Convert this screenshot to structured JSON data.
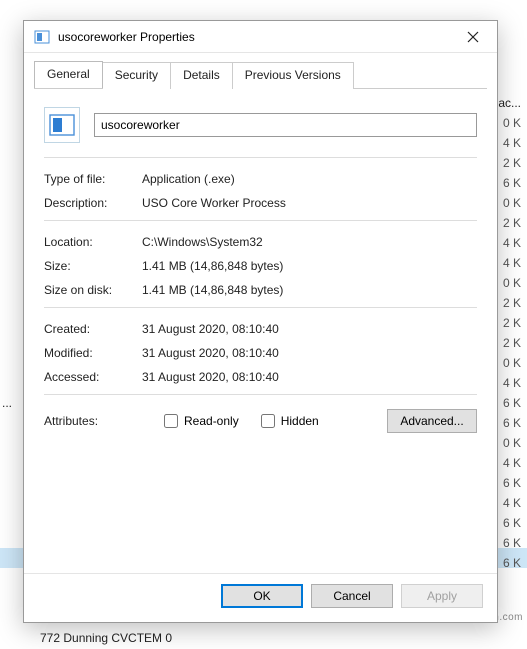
{
  "dialog": {
    "title": "usocoreworker Properties",
    "tabs": [
      "General",
      "Security",
      "Details",
      "Previous Versions"
    ],
    "active_tab": 0,
    "name_value": "usocoreworker",
    "fields": {
      "type_label": "Type of file:",
      "type_value": "Application (.exe)",
      "desc_label": "Description:",
      "desc_value": "USO Core Worker Process",
      "loc_label": "Location:",
      "loc_value": "C:\\Windows\\System32",
      "size_label": "Size:",
      "size_value": "1.41 MB (14,86,848 bytes)",
      "disk_label": "Size on disk:",
      "disk_value": "1.41 MB (14,86,848 bytes)",
      "created_label": "Created:",
      "created_value": "31 August 2020, 08:10:40",
      "modified_label": "Modified:",
      "modified_value": "31 August 2020, 08:10:40",
      "accessed_label": "Accessed:",
      "accessed_value": "31 August 2020, 08:10:40",
      "attr_label": "Attributes:",
      "readonly_label": "Read-only",
      "hidden_label": "Hidden",
      "advanced_label": "Advanced..."
    },
    "buttons": {
      "ok": "OK",
      "cancel": "Cancel",
      "apply": "Apply"
    }
  },
  "background": {
    "header_text": "ac...",
    "rows": [
      "0 K",
      "4 K",
      "2 K",
      "6 K",
      "0 K",
      "2 K",
      "4 K",
      "4 K",
      "0 K",
      "2 K",
      "2 K",
      "2 K",
      "0 K",
      "4 K",
      "6 K",
      "6 K",
      "0 K",
      "4 K",
      "6 K",
      "4 K",
      "6 K",
      "6 K",
      "6 K"
    ],
    "dots": "...",
    "bottom": "772        Dunning                                 CVCTEM                       0",
    "watermark": "wsxdn.com"
  }
}
